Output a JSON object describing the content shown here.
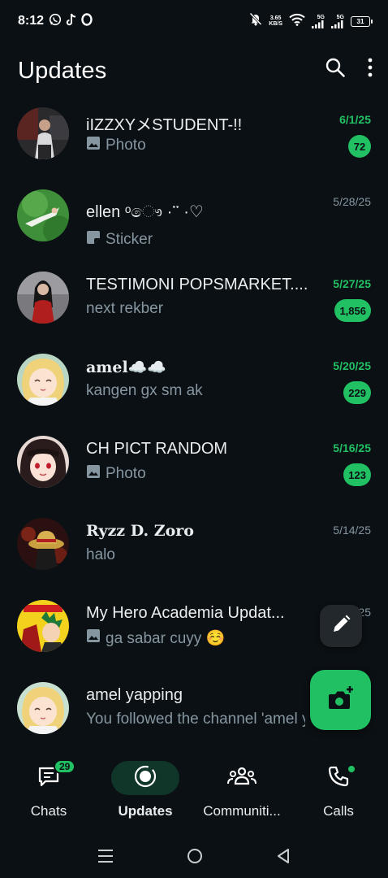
{
  "status_bar": {
    "time": "8:12",
    "net_speed_value": "3.65",
    "net_speed_unit": "KB/S",
    "signal1_label": "5G",
    "signal2_label": "5G",
    "battery_level": "31",
    "icons": [
      "whatsapp-icon",
      "tiktok-icon",
      "opera-icon",
      "mute-icon",
      "wifi-icon",
      "signal-icon",
      "battery-icon"
    ]
  },
  "header": {
    "title": "Updates",
    "icons": [
      "search-icon",
      "more-options-icon"
    ]
  },
  "colors": {
    "background": "#0b1014",
    "accent": "#21c063",
    "muted_text": "#8696a0",
    "active_nav_pill": "#103529"
  },
  "updates": [
    {
      "name": "iIZZXYメSTUDENT-!!",
      "subtitle": "Photo",
      "subtitle_icon": "photo-icon",
      "date": "6/1/25",
      "unread": "72"
    },
    {
      "name": "ellen ᵒෞ ·་་ ·♡",
      "subtitle": "Sticker",
      "subtitle_icon": "sticker-icon",
      "date": "5/28/25",
      "unread": ""
    },
    {
      "name": "TESTIMONI POPSMARKET....",
      "subtitle": "next rekber",
      "subtitle_icon": "",
      "date": "5/27/25",
      "unread": "1,856"
    },
    {
      "name": "amel☁️☁️",
      "subtitle": "kangen gx sm ak",
      "subtitle_icon": "",
      "date": "5/20/25",
      "unread": "229"
    },
    {
      "name": "CH PICT RANDOM",
      "subtitle": "Photo",
      "subtitle_icon": "photo-icon",
      "date": "5/16/25",
      "unread": "123"
    },
    {
      "name": "Ryzz D. Zoro",
      "subtitle": "halo",
      "subtitle_icon": "",
      "date": "5/14/25",
      "unread": ""
    },
    {
      "name": "My Hero Academia Updat...",
      "subtitle": "ga sabar cuyy ☺️",
      "subtitle_icon": "photo-icon",
      "date": "5/9/25",
      "unread": ""
    },
    {
      "name": "amel yapping",
      "subtitle": "You followed the channel 'amel yapping'",
      "subtitle_icon": "",
      "date": "",
      "unread": ""
    }
  ],
  "fabs": {
    "edit_icon": "pencil-icon",
    "camera_icon": "camera-add-icon"
  },
  "bottom_nav": {
    "items": [
      {
        "label": "Chats",
        "icon": "chats-icon",
        "badge": "29"
      },
      {
        "label": "Updates",
        "icon": "updates-icon",
        "active": true
      },
      {
        "label": "Communiti...",
        "icon": "communities-icon"
      },
      {
        "label": "Calls",
        "icon": "calls-icon"
      }
    ]
  },
  "system_nav": [
    "menu-icon",
    "home-icon",
    "back-icon"
  ]
}
